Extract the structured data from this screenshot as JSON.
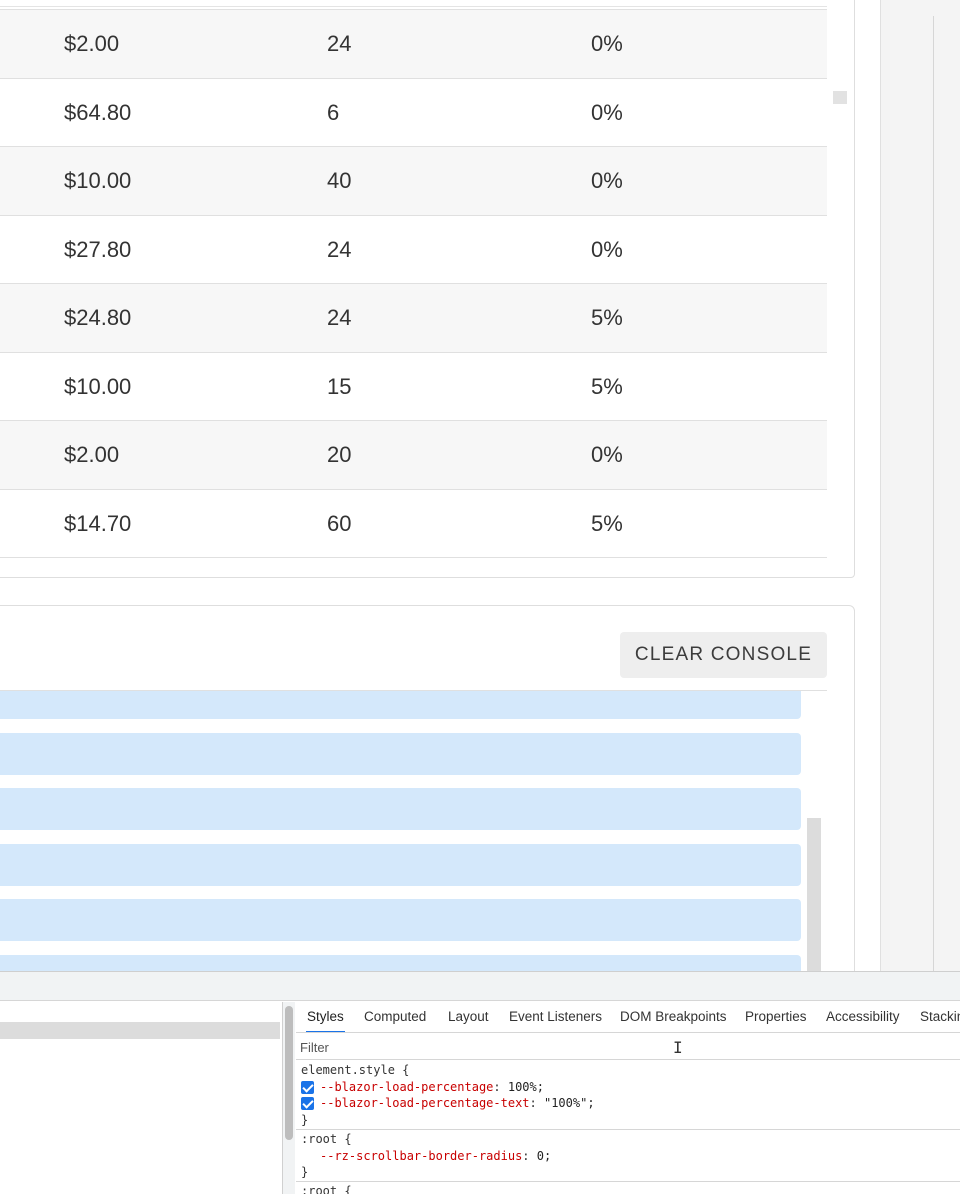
{
  "grid": {
    "rows": [
      {
        "price": "$2.00",
        "qty": "24",
        "discount": "0%"
      },
      {
        "price": "$64.80",
        "qty": "6",
        "discount": "0%"
      },
      {
        "price": "$10.00",
        "qty": "40",
        "discount": "0%"
      },
      {
        "price": "$27.80",
        "qty": "24",
        "discount": "0%"
      },
      {
        "price": "$24.80",
        "qty": "24",
        "discount": "5%"
      },
      {
        "price": "$10.00",
        "qty": "15",
        "discount": "5%"
      },
      {
        "price": "$2.00",
        "qty": "20",
        "discount": "0%"
      },
      {
        "price": "$14.70",
        "qty": "60",
        "discount": "5%"
      }
    ]
  },
  "console": {
    "clear_label": "CLEAR CONSOLE"
  },
  "devtools": {
    "tabs": [
      {
        "label": "Styles",
        "active": true
      },
      {
        "label": "Computed"
      },
      {
        "label": "Layout"
      },
      {
        "label": "Event Listeners"
      },
      {
        "label": "DOM Breakpoints"
      },
      {
        "label": "Properties"
      },
      {
        "label": "Accessibility"
      },
      {
        "label": "Stacking"
      }
    ],
    "filter_placeholder": "Filter",
    "rules": [
      {
        "selector": "element.style {",
        "declarations": [
          {
            "prop": "--blazor-load-percentage",
            "value": "100%;",
            "checked": true
          },
          {
            "prop": "--blazor-load-percentage-text",
            "value": "\"100%\";",
            "checked": true
          }
        ]
      },
      {
        "selector": ":root {",
        "declarations": [
          {
            "prop": "--rz-scrollbar-border-radius",
            "value": "0;",
            "checked": false
          }
        ]
      },
      {
        "selector": ":root {",
        "declarations": []
      }
    ],
    "closing_brace": "}"
  },
  "colors": {
    "accent": "#1a73e8",
    "log_entry_bg": "#d4e8fb",
    "css_property": "#c80000"
  }
}
